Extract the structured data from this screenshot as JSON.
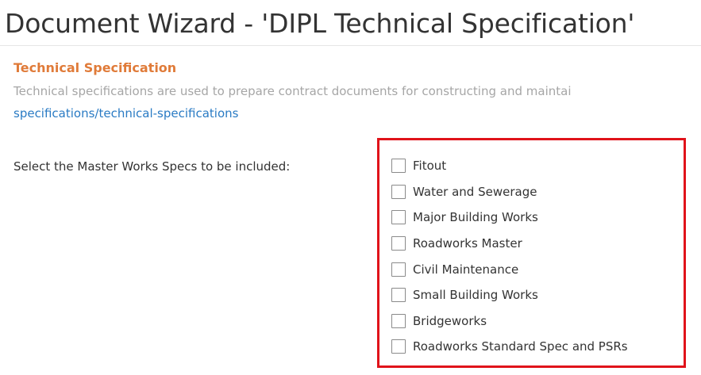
{
  "window": {
    "title": "Document Wizard - 'DIPL Technical Specification'"
  },
  "section": {
    "heading": "Technical Specification",
    "description": "Technical specifications are used to prepare contract documents for constructing and maintai",
    "link_text": "specifications/technical-specifications"
  },
  "form": {
    "label": "Select the Master Works Specs to be included:",
    "options": [
      {
        "label": "Fitout",
        "checked": false
      },
      {
        "label": "Water and Sewerage",
        "checked": false
      },
      {
        "label": "Major Building Works",
        "checked": false
      },
      {
        "label": "Roadworks Master",
        "checked": false
      },
      {
        "label": "Civil Maintenance",
        "checked": false
      },
      {
        "label": "Small Building Works",
        "checked": false
      },
      {
        "label": "Bridgeworks",
        "checked": false
      },
      {
        "label": "Roadworks Standard Spec and PSRs",
        "checked": false
      }
    ]
  },
  "colors": {
    "heading": "#e07b39",
    "link": "#2a7bc4",
    "highlight_border": "#e0131a",
    "description": "#a6a6a6"
  }
}
